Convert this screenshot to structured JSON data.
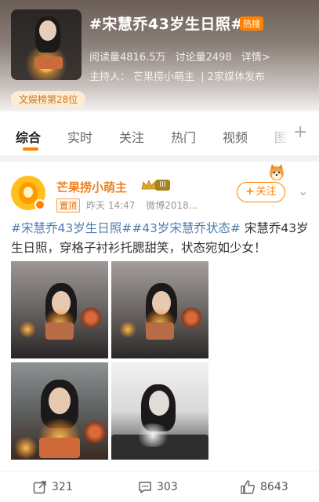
{
  "topic": {
    "title": "#宋慧乔43岁生日照#",
    "hot_badge": "热搜",
    "reads": "阅读量4816.5万",
    "discussions": "讨论量2498",
    "details": "详情>",
    "host_label": "主持人：",
    "host_name": "芒果捞小萌主",
    "media": "| 2家媒体发布",
    "rank": "文娱榜第28位"
  },
  "tabs": [
    {
      "label": "综合",
      "active": true
    },
    {
      "label": "实时",
      "active": false
    },
    {
      "label": "关注",
      "active": false
    },
    {
      "label": "热门",
      "active": false
    },
    {
      "label": "视频",
      "active": false
    },
    {
      "label": "图",
      "active": false
    }
  ],
  "post": {
    "author": "芒果捞小萌主",
    "level": "III",
    "pinned": "置顶",
    "time": "昨天 14:47",
    "source": "微博2018...",
    "follow_label": "关注",
    "tag1": "#宋慧乔43岁生日照#",
    "tag2": "#43岁宋慧乔状态#",
    "body": " 宋慧乔43岁生日照，穿格子衬衫托腮甜笑，状态宛如少女！"
  },
  "actions": {
    "repost": "321",
    "comment": "303",
    "like": "8643"
  },
  "colors": {
    "accent": "#ff8200",
    "link": "#507daf"
  }
}
